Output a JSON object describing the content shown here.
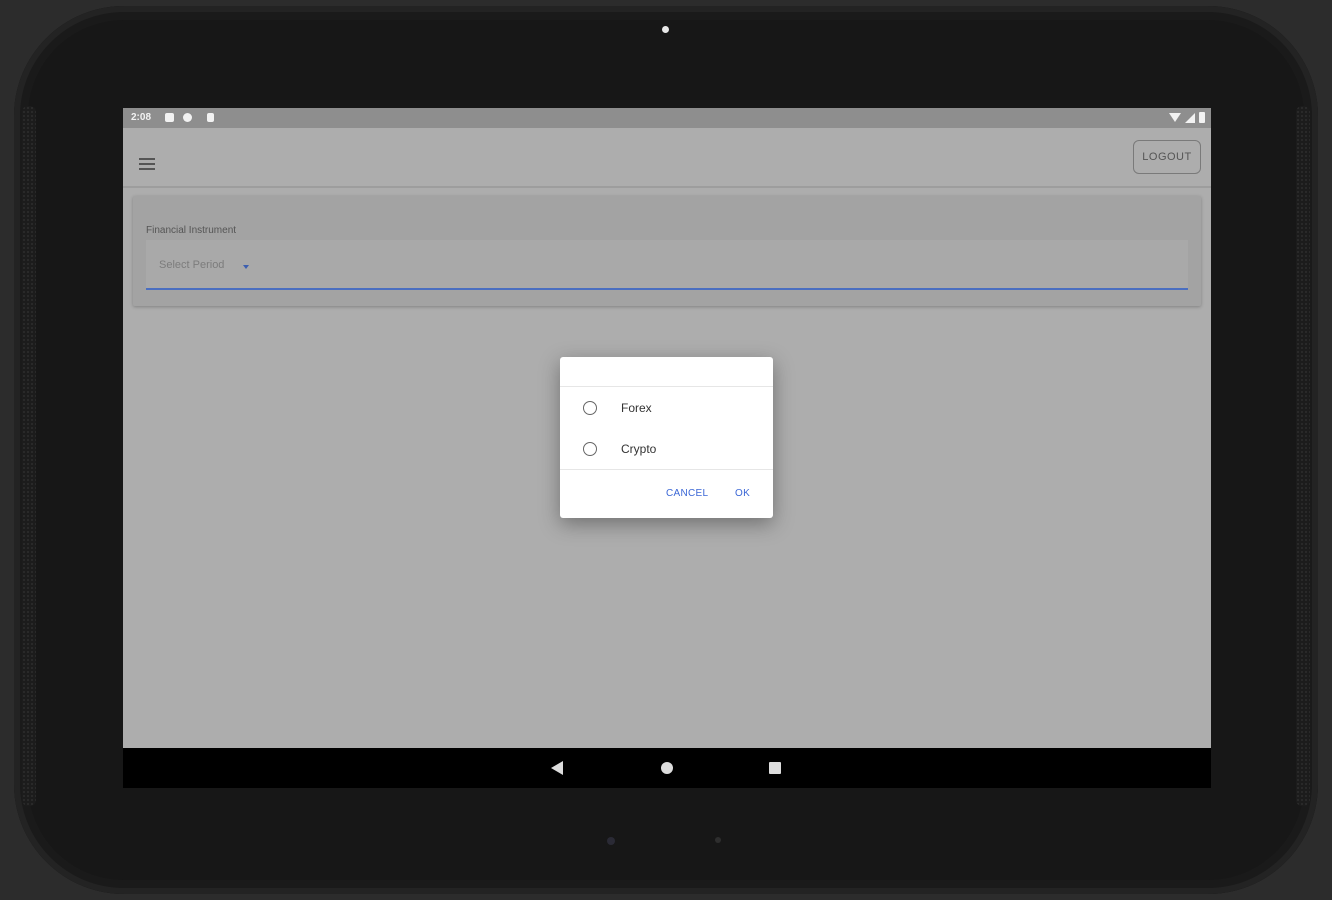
{
  "status_bar": {
    "time": "2:08"
  },
  "app_bar": {
    "logout_label": "LOGOUT"
  },
  "form": {
    "field_label": "Financial Instrument",
    "select_placeholder": "Select Period"
  },
  "dialog": {
    "options": [
      {
        "label": "Forex",
        "selected": false
      },
      {
        "label": "Crypto",
        "selected": false
      }
    ],
    "cancel_label": "CANCEL",
    "ok_label": "OK"
  },
  "colors": {
    "accent": "#3b67d6",
    "underline": "#4a6ec0"
  },
  "icons": {
    "menu": "hamburger-menu-icon",
    "back": "nav-back-icon",
    "home": "nav-home-icon",
    "recents": "nav-recents-icon"
  }
}
